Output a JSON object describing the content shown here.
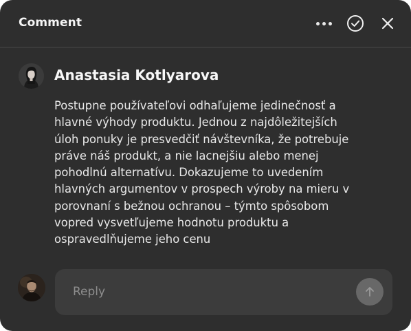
{
  "header": {
    "title": "Comment",
    "icons": {
      "more": "more-horizontal-icon",
      "resolve": "check-circle-icon",
      "close": "close-icon"
    }
  },
  "comment": {
    "author": "Anastasia Kotlyarova",
    "text": "Postupne používateľovi odhaľujeme jedinečnosť a\nhlavné výhody produktu. Jednou z najdôležitejších\núloh ponuky je presvedčiť návštevníka, že potrebuje\npráve náš produkt, a nie lacnejšiu alebo menej\npohodlnú alternatívu. Dokazujeme to uvedením\nhlavných argumentov v prospech výroby na mieru v\nporovnaní s bežnou ochranou – týmto spôsobom\nvopred vysvetľujeme hodnotu produktu a\nospravedlňujeme jeho cenu"
  },
  "reply": {
    "placeholder": "Reply",
    "send_icon": "arrow-up-icon"
  },
  "colors": {
    "panel_bg": "#2e2e2e",
    "input_bg": "#3c3c3c",
    "send_btn": "#686868",
    "text": "#f2f2f2"
  }
}
